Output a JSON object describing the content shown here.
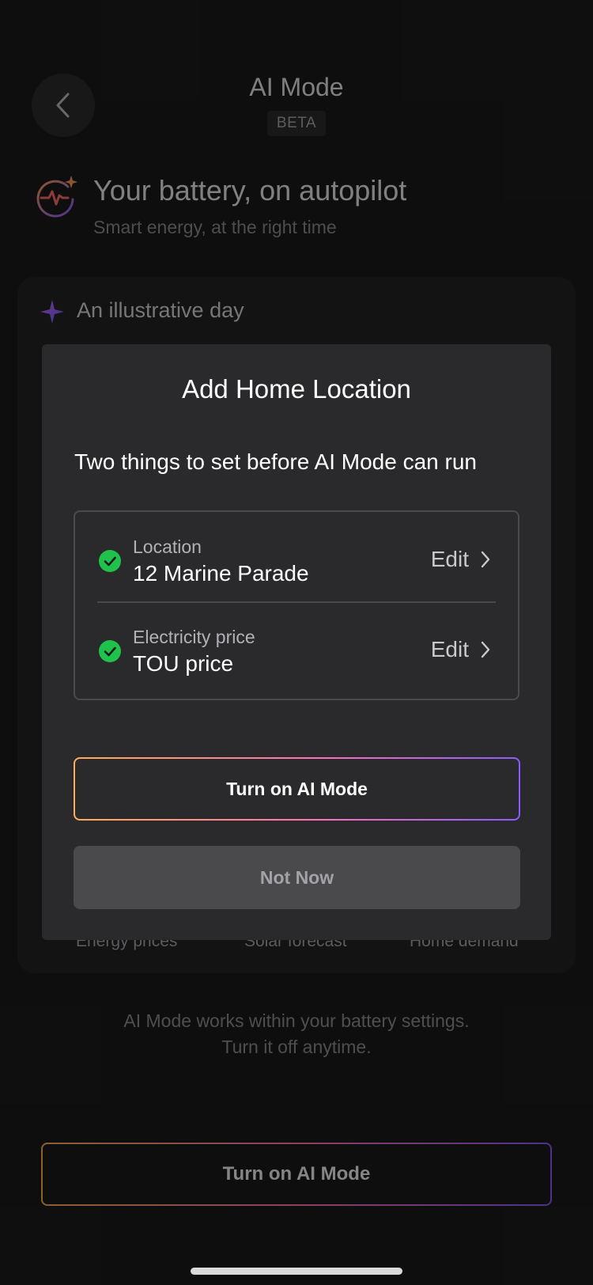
{
  "header": {
    "title": "AI Mode",
    "badge": "BETA"
  },
  "hero": {
    "title": "Your battery, on autopilot",
    "subtitle": "Smart energy, at the right time"
  },
  "illustration": {
    "label": "An illustrative day",
    "legend": [
      "Energy prices",
      "Solar forecast",
      "Home demand"
    ]
  },
  "footnote": {
    "line1": "AI Mode works within your battery settings.",
    "line2": "Turn it off anytime."
  },
  "bottom_cta": {
    "label": "Turn on AI Mode"
  },
  "modal": {
    "title": "Add Home Location",
    "subtitle": "Two things to set before AI Mode can run",
    "items": [
      {
        "label": "Location",
        "value": "12 Marine Parade",
        "action": "Edit",
        "status": "complete"
      },
      {
        "label": "Electricity price",
        "value": "TOU price",
        "action": "Edit",
        "status": "complete"
      }
    ],
    "primary_button": "Turn on AI Mode",
    "secondary_button": "Not Now"
  },
  "colors": {
    "check_green": "#1fc24a",
    "gradient_start": "#ffae57",
    "gradient_mid": "#ff70b8",
    "gradient_end": "#8a5cff"
  }
}
